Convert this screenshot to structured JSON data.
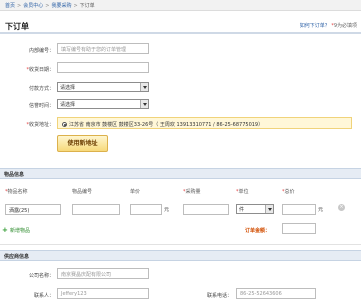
{
  "breadcrumb": {
    "home": "首页",
    "center": "会员中心",
    "purchase": "我要采购",
    "current": "下订单",
    "sep": ">"
  },
  "header": {
    "title": "下订单",
    "help_link": "如何下订单？",
    "help_suffix": "9为必填项"
  },
  "form": {
    "internal_no": {
      "label": "内部编号：",
      "placeholder": "填写编号有助于您的订单管理"
    },
    "receive_date": {
      "label": "收货日期："
    },
    "payment": {
      "label": "付款方式：",
      "value": "请选择"
    },
    "delivery_time": {
      "label": "信誉时间：",
      "value": "请选择"
    },
    "address": {
      "label": "收货地址：",
      "value": "江苏省 南京市 鼓楼区 鼓楼区33-26号（ 王周欢 13913310771 / 86-25-68775019）"
    },
    "new_address_btn": "使用新地址"
  },
  "products": {
    "section_title": "物品信息",
    "columns": [
      "物品名称",
      "物品编号",
      "单价",
      "采购量",
      "单位",
      "总价"
    ],
    "row": {
      "name": "洒露(25)",
      "unit_price_suffix": "元",
      "unit": "件",
      "total_suffix": "元"
    },
    "add_link": "新增物品",
    "amount_label": "订单金额："
  },
  "supplier": {
    "section_title": "供应商信息",
    "company_label": "公司名称：",
    "company_value": "南京赛晶庆配有限公司",
    "contact_label": "联系人：",
    "contact_value": "Jeffery123",
    "phone_label": "联系电话：",
    "phone_value": "86-25-52643606"
  }
}
